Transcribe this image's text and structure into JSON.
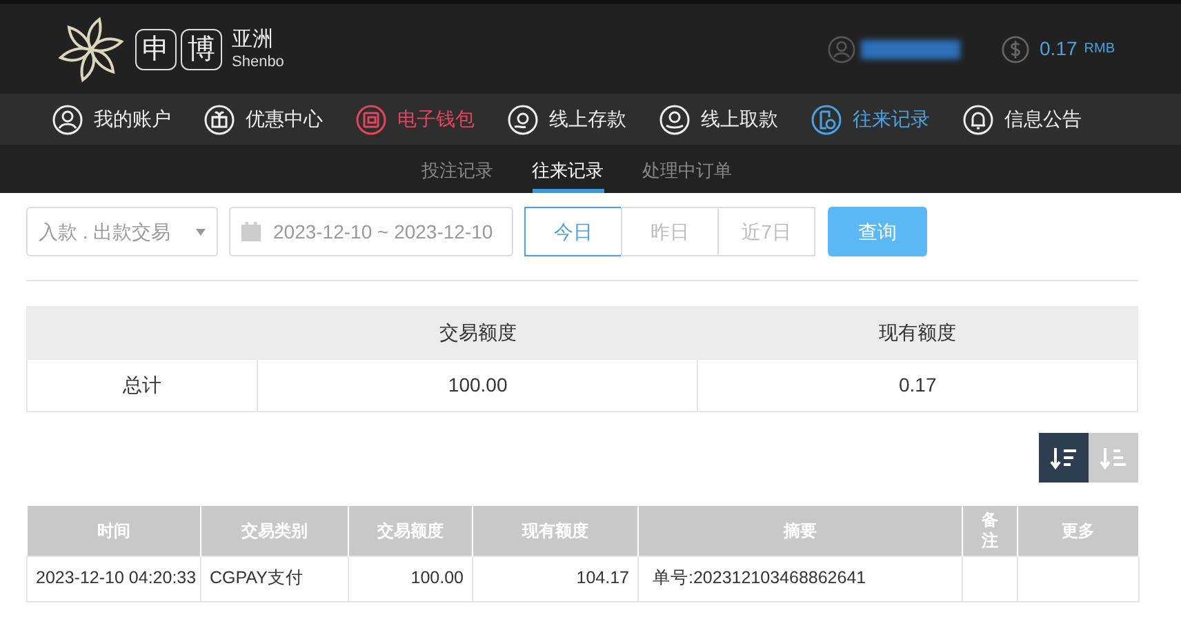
{
  "logo": {
    "boxes": [
      "申",
      "博"
    ],
    "name": "亚洲",
    "latin": "Shenbo"
  },
  "account": {
    "balance": "0.17",
    "currency": "RMB"
  },
  "nav": [
    {
      "label": "我的账户",
      "kind": "user",
      "selected": false,
      "hot": false
    },
    {
      "label": "优惠中心",
      "kind": "gift",
      "selected": false,
      "hot": false
    },
    {
      "label": "电子钱包",
      "kind": "wallet",
      "selected": false,
      "hot": true
    },
    {
      "label": "线上存款",
      "kind": "deposit",
      "selected": false,
      "hot": false
    },
    {
      "label": "线上取款",
      "kind": "withdraw",
      "selected": false,
      "hot": false
    },
    {
      "label": "往来记录",
      "kind": "record",
      "selected": true,
      "hot": false
    },
    {
      "label": "信息公告",
      "kind": "bell",
      "selected": false,
      "hot": false
    }
  ],
  "subtabs": [
    {
      "label": "投注记录",
      "selected": false
    },
    {
      "label": "往来记录",
      "selected": true
    },
    {
      "label": "处理中订单",
      "selected": false
    }
  ],
  "filter": {
    "type_select": "入款 . 出款交易",
    "date_range": "2023-12-10 ~ 2023-12-10",
    "ranges": [
      {
        "label": "今日",
        "selected": true
      },
      {
        "label": "昨日",
        "selected": false
      },
      {
        "label": "近7日",
        "selected": false
      }
    ],
    "query_button": "查询"
  },
  "summary": {
    "columns": [
      "",
      "交易额度",
      "现有额度"
    ],
    "rows": [
      [
        "总计",
        "100.00",
        "0.17"
      ]
    ]
  },
  "sort_buttons": [
    {
      "kind": "desc",
      "selected": true
    },
    {
      "kind": "asc",
      "selected": false
    }
  ],
  "table": {
    "columns": [
      "时间",
      "交易类别",
      "交易额度",
      "现有额度",
      "摘要",
      "备注",
      "更多"
    ],
    "rows": [
      [
        "2023-12-10 04:20:33",
        "CGPAY支付",
        "100.00",
        "104.17",
        "单号:202312103468862641",
        "",
        ""
      ]
    ]
  }
}
